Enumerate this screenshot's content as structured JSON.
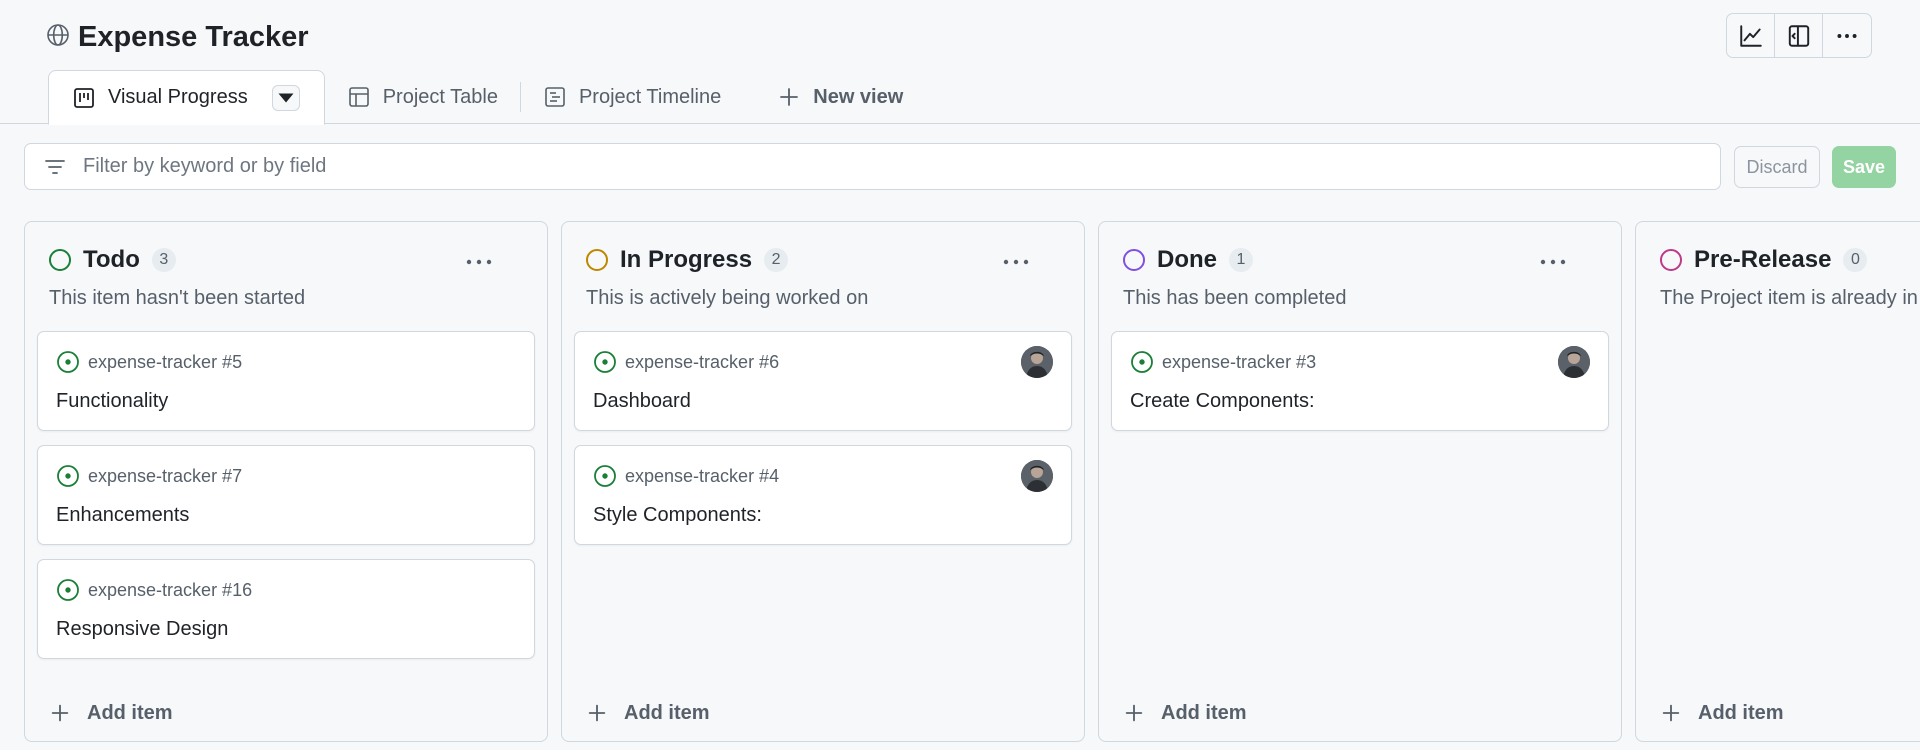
{
  "project": {
    "title": "Expense Tracker",
    "icon": "globe-icon"
  },
  "top_actions": [
    {
      "name": "insights-icon"
    },
    {
      "name": "side-panel-icon"
    },
    {
      "name": "kebab-icon"
    }
  ],
  "tabs": [
    {
      "label": "Visual Progress",
      "icon": "board-icon",
      "active": true
    },
    {
      "label": "Project Table",
      "icon": "table-icon",
      "active": false
    },
    {
      "label": "Project Timeline",
      "icon": "roadmap-icon",
      "active": false
    },
    {
      "label": "New view",
      "icon": "plus-icon",
      "active": false
    }
  ],
  "filter": {
    "placeholder": "Filter by keyword or by field",
    "value": ""
  },
  "buttons": {
    "discard": "Discard",
    "save": "Save"
  },
  "columns": [
    {
      "name": "Todo",
      "count": "3",
      "color": "#1a7f37",
      "description": "This item hasn't been started",
      "add_label": "Add item",
      "cards": [
        {
          "ref": "expense-tracker #5",
          "title": "Functionality"
        },
        {
          "ref": "expense-tracker #7",
          "title": "Enhancements"
        },
        {
          "ref": "expense-tracker #16",
          "title": "Responsive Design"
        }
      ]
    },
    {
      "name": "In Progress",
      "count": "2",
      "color": "#bf8700",
      "description": "This is actively being worked on",
      "add_label": "Add item",
      "cards": [
        {
          "ref": "expense-tracker #6",
          "title": "Dashboard"
        },
        {
          "ref": "expense-tracker #4",
          "title": "Style Components:"
        }
      ]
    },
    {
      "name": "Done",
      "count": "1",
      "color": "#8250df",
      "description": "This has been completed",
      "add_label": "Add item",
      "cards": [
        {
          "ref": "expense-tracker #3",
          "title": "Create Components:"
        }
      ]
    },
    {
      "name": "Pre-Release",
      "count": "0",
      "color": "#bf3989",
      "description": "The Project item is already in",
      "add_label": "Add item",
      "cards": []
    }
  ]
}
